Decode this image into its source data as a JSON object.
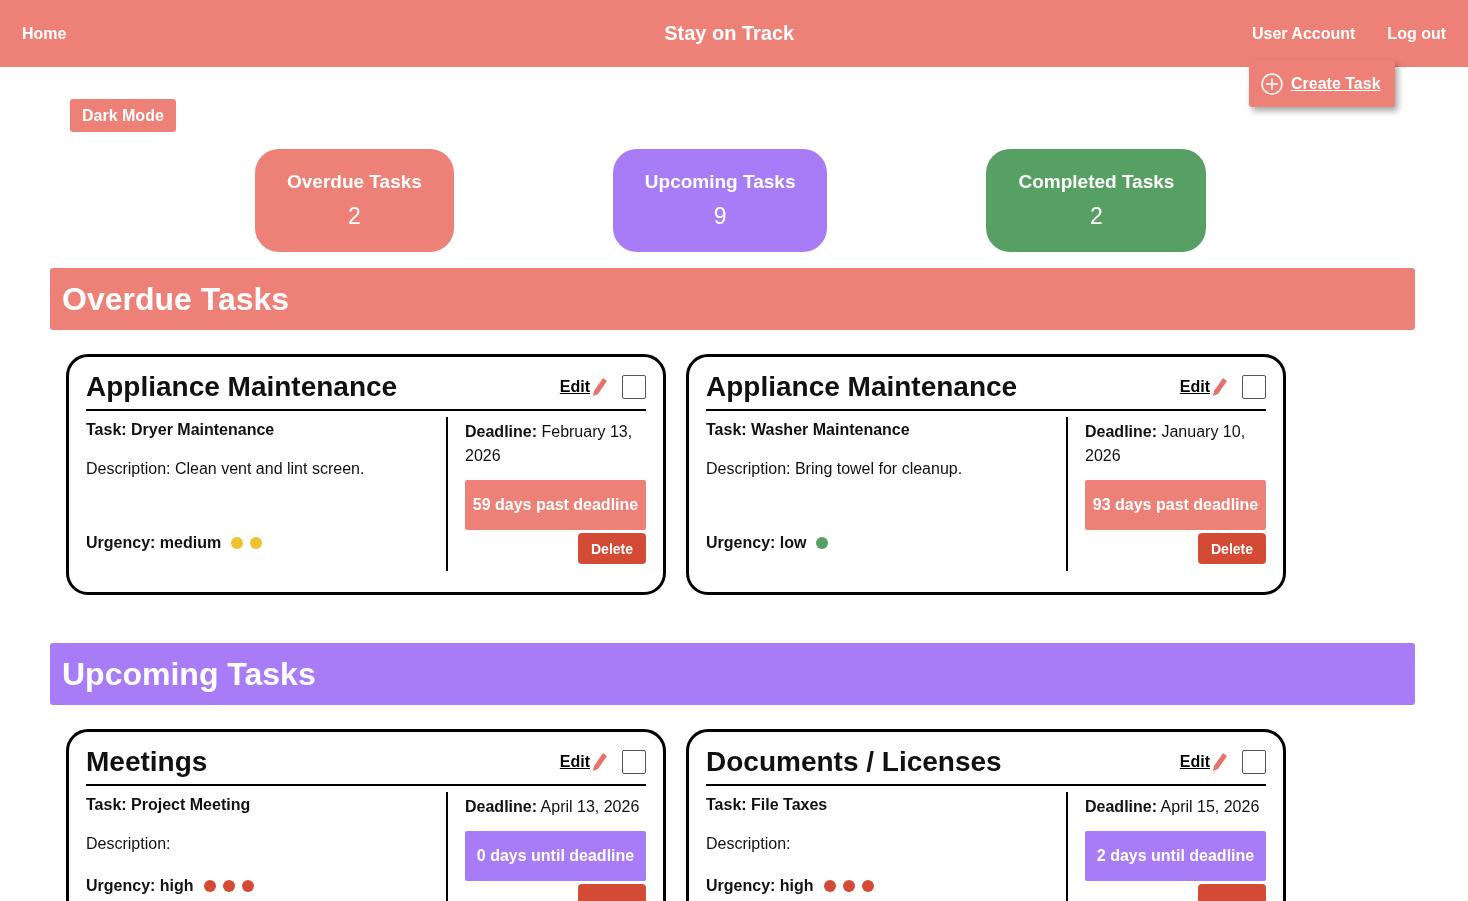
{
  "nav": {
    "home": "Home",
    "title": "Stay on Track",
    "links": [
      "User Account",
      "Log out"
    ]
  },
  "create_task": "Create Task",
  "dark_mode": "Dark Mode",
  "summary": [
    {
      "kind": "overdue",
      "label": "Overdue Tasks",
      "count": "2"
    },
    {
      "kind": "upcoming",
      "label": "Upcoming Tasks",
      "count": "9"
    },
    {
      "kind": "completed",
      "label": "Completed Tasks",
      "count": "2"
    }
  ],
  "sections": [
    {
      "kind": "overdue",
      "title": "Overdue Tasks",
      "cards": [
        {
          "category": "Appliance Maintenance",
          "edit": "Edit",
          "checked": false,
          "task_label": "Task:",
          "task": "Dryer Maintenance",
          "description_label": "Description:",
          "description": "Clean vent and lint screen.",
          "urgency_label": "Urgency:",
          "urgency": "medium",
          "dots": [
            {
              "color": "#f0c22e"
            },
            {
              "color": "#f0c22e"
            }
          ],
          "deadline_label": "Deadline:",
          "deadline": "February 13, 2026",
          "status": "59 days past deadline",
          "delete": "Delete"
        },
        {
          "category": "Appliance Maintenance",
          "edit": "Edit",
          "checked": false,
          "task_label": "Task:",
          "task": "Washer Maintenance",
          "description_label": "Description:",
          "description": "Bring towel for cleanup.",
          "urgency_label": "Urgency:",
          "urgency": "low",
          "dots": [
            {
              "color": "#57a063"
            }
          ],
          "deadline_label": "Deadline:",
          "deadline": "January 10, 2026",
          "status": "93 days past deadline",
          "delete": "Delete"
        }
      ]
    },
    {
      "kind": "upcoming",
      "title": "Upcoming Tasks",
      "cards": [
        {
          "category": "Meetings",
          "edit": "Edit",
          "checked": false,
          "task_label": "Task:",
          "task": "Project Meeting",
          "description_label": "Description:",
          "urgency_label": "Urgency:",
          "urgency": "high",
          "dots": [
            {
              "color": "#d44b35"
            },
            {
              "color": "#d44b35"
            },
            {
              "color": "#d44b35"
            }
          ],
          "deadline_label": "Deadline:",
          "deadline": "April 13, 2026",
          "status": "0 days until deadline"
        },
        {
          "category": "Documents / Licenses",
          "edit": "Edit",
          "checked": false,
          "task_label": "Task:",
          "task": "File Taxes",
          "description_label": "Description:",
          "urgency_label": "Urgency:",
          "urgency": "high",
          "dots": [
            {
              "color": "#d44b35"
            },
            {
              "color": "#d44b35"
            },
            {
              "color": "#d44b35"
            }
          ],
          "deadline_label": "Deadline:",
          "deadline": "April 15, 2026",
          "status": "2 days until deadline"
        }
      ]
    }
  ]
}
